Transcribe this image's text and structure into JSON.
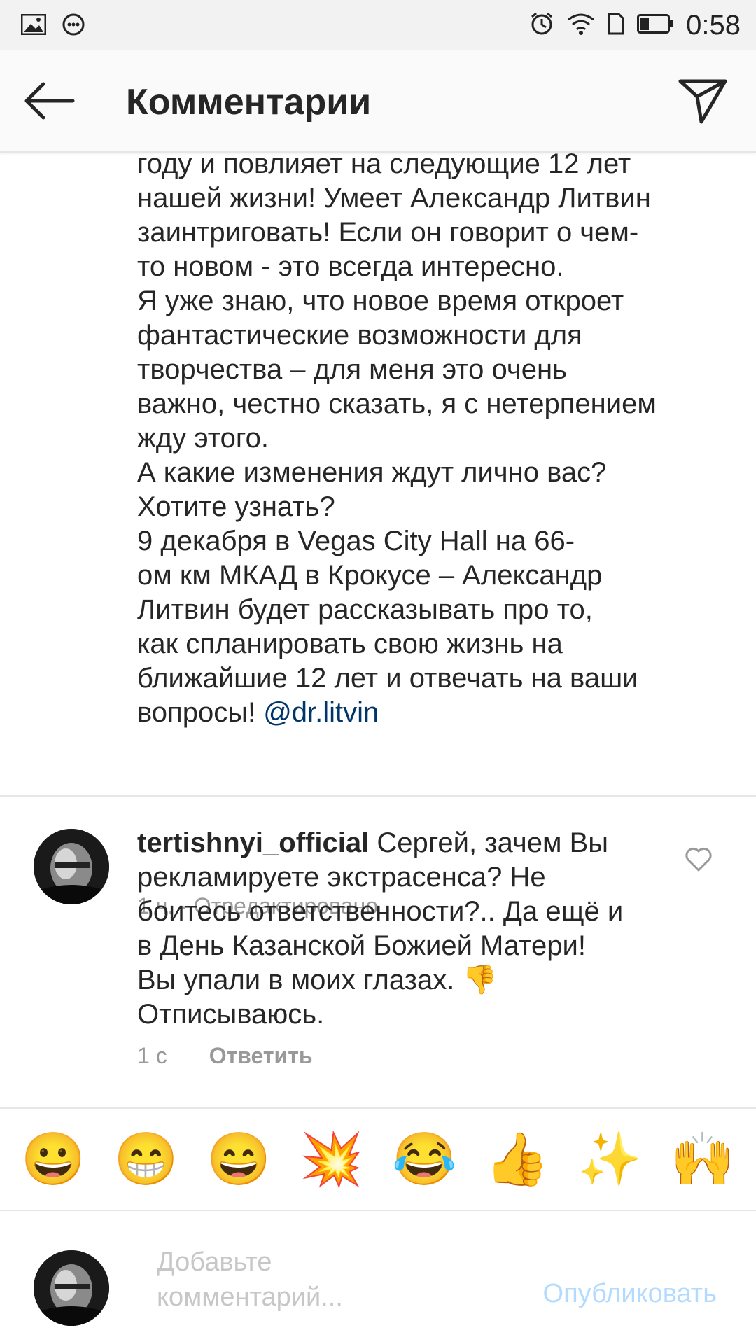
{
  "status_bar": {
    "time": "0:58"
  },
  "header": {
    "title": "Комментарии"
  },
  "continued_comment": {
    "text": "году и повлияет на следующие 12 лет\nнашей жизни! Умеет Александр Литвин\nзаинтриговать! Если он говорит о чем-\nто новом - это всегда интересно.\nЯ уже знаю, что новое время откроет\nфантастические возможности для\nтворчества – для меня это очень\nважно, честно сказать, я с нетерпением\nжду этого.\nА какие изменения ждут лично вас?\nХотите узнать?\n9 декабря в Vegas City Hall на 66-\nом км МКАД в Крокусе – Александр\nЛитвин будет рассказывать про то,\nкак спланировать свою жизнь на\nближайшие 12 лет и отвечать на ваши\nвопросы! ",
    "mention": "@dr.litvin",
    "meta": "1 ч. · Отредактировано"
  },
  "comment": {
    "username": "tertishnyi_official",
    "text": " Сергей, зачем Вы рекламируете экстрасенса? Не боитесь ответственности?.. Да ещё и в День Казанской Божией Матери! Вы упали в моих глазах. 👎 Отписываюсь.",
    "time": "1 с",
    "reply_label": "Ответить"
  },
  "emoji_bar": [
    "😀",
    "😁",
    "😄",
    "💥",
    "😂",
    "👍",
    "✨",
    "🙌"
  ],
  "input": {
    "placeholder": "Добавьте комментарий...",
    "publish_label": "Опубликовать"
  },
  "colors": {
    "mention": "#003569",
    "meta": "#999999",
    "publish": "#b3dbff"
  }
}
